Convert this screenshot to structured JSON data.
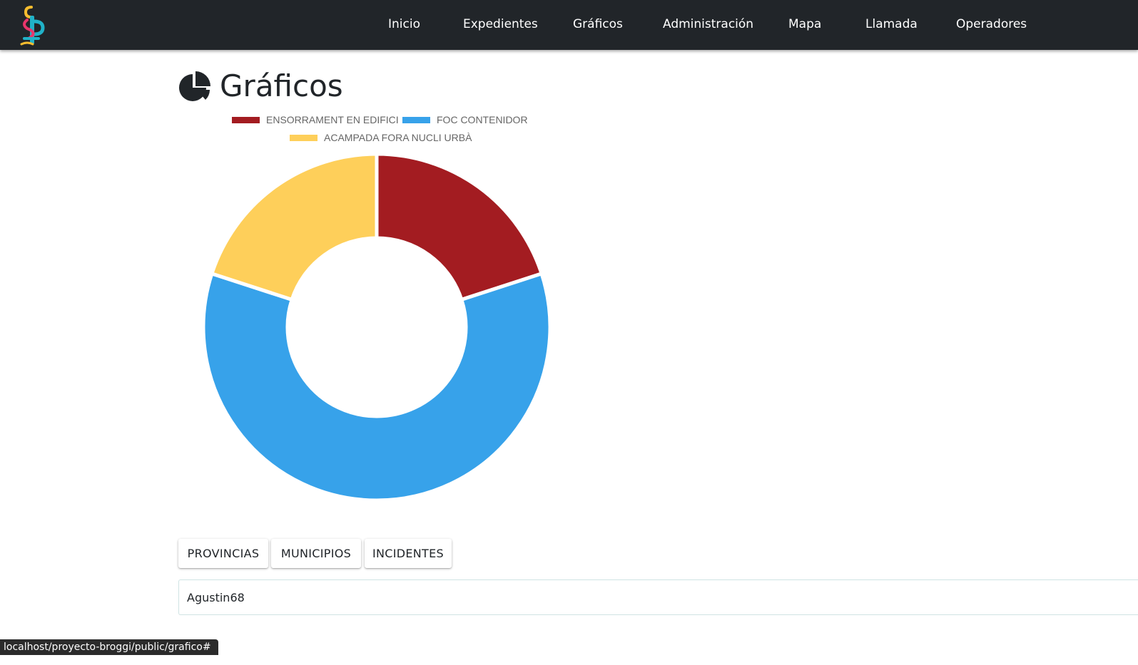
{
  "nav": {
    "brand": "logo",
    "links": [
      "Inicio",
      "Expedientes",
      "Gráficos",
      "Administración",
      "Mapa",
      "Llamada",
      "Operadores"
    ]
  },
  "page": {
    "title": "Gráficos",
    "title_icon": "chart-pie-icon"
  },
  "chart_data": {
    "type": "pie",
    "variant": "doughnut",
    "labels": [
      "ENSORRAMENT EN EDIFICI",
      "FOC CONTENIDOR",
      "ACAMPADA FORA NUCLI URBÀ"
    ],
    "values": [
      1,
      3,
      1
    ],
    "colors": [
      "#a31c21",
      "#37a2ea",
      "#fecf5a"
    ],
    "legend": "top",
    "start_angle": "top",
    "direction": "clockwise"
  },
  "buttons": {
    "provincias": "PROVINCIAS",
    "municipios": "MUNICIPIOS",
    "incidentes": "INCIDENTES"
  },
  "info": {
    "text": "Agustin68"
  },
  "status_bar": {
    "url": "localhost/proyecto-broggi/public/grafico#"
  },
  "colors": {
    "navbar": "#212529",
    "accent_teal": "#20b2c8",
    "accent_pink": "#e8356b",
    "accent_yellow": "#f6bd2f"
  }
}
